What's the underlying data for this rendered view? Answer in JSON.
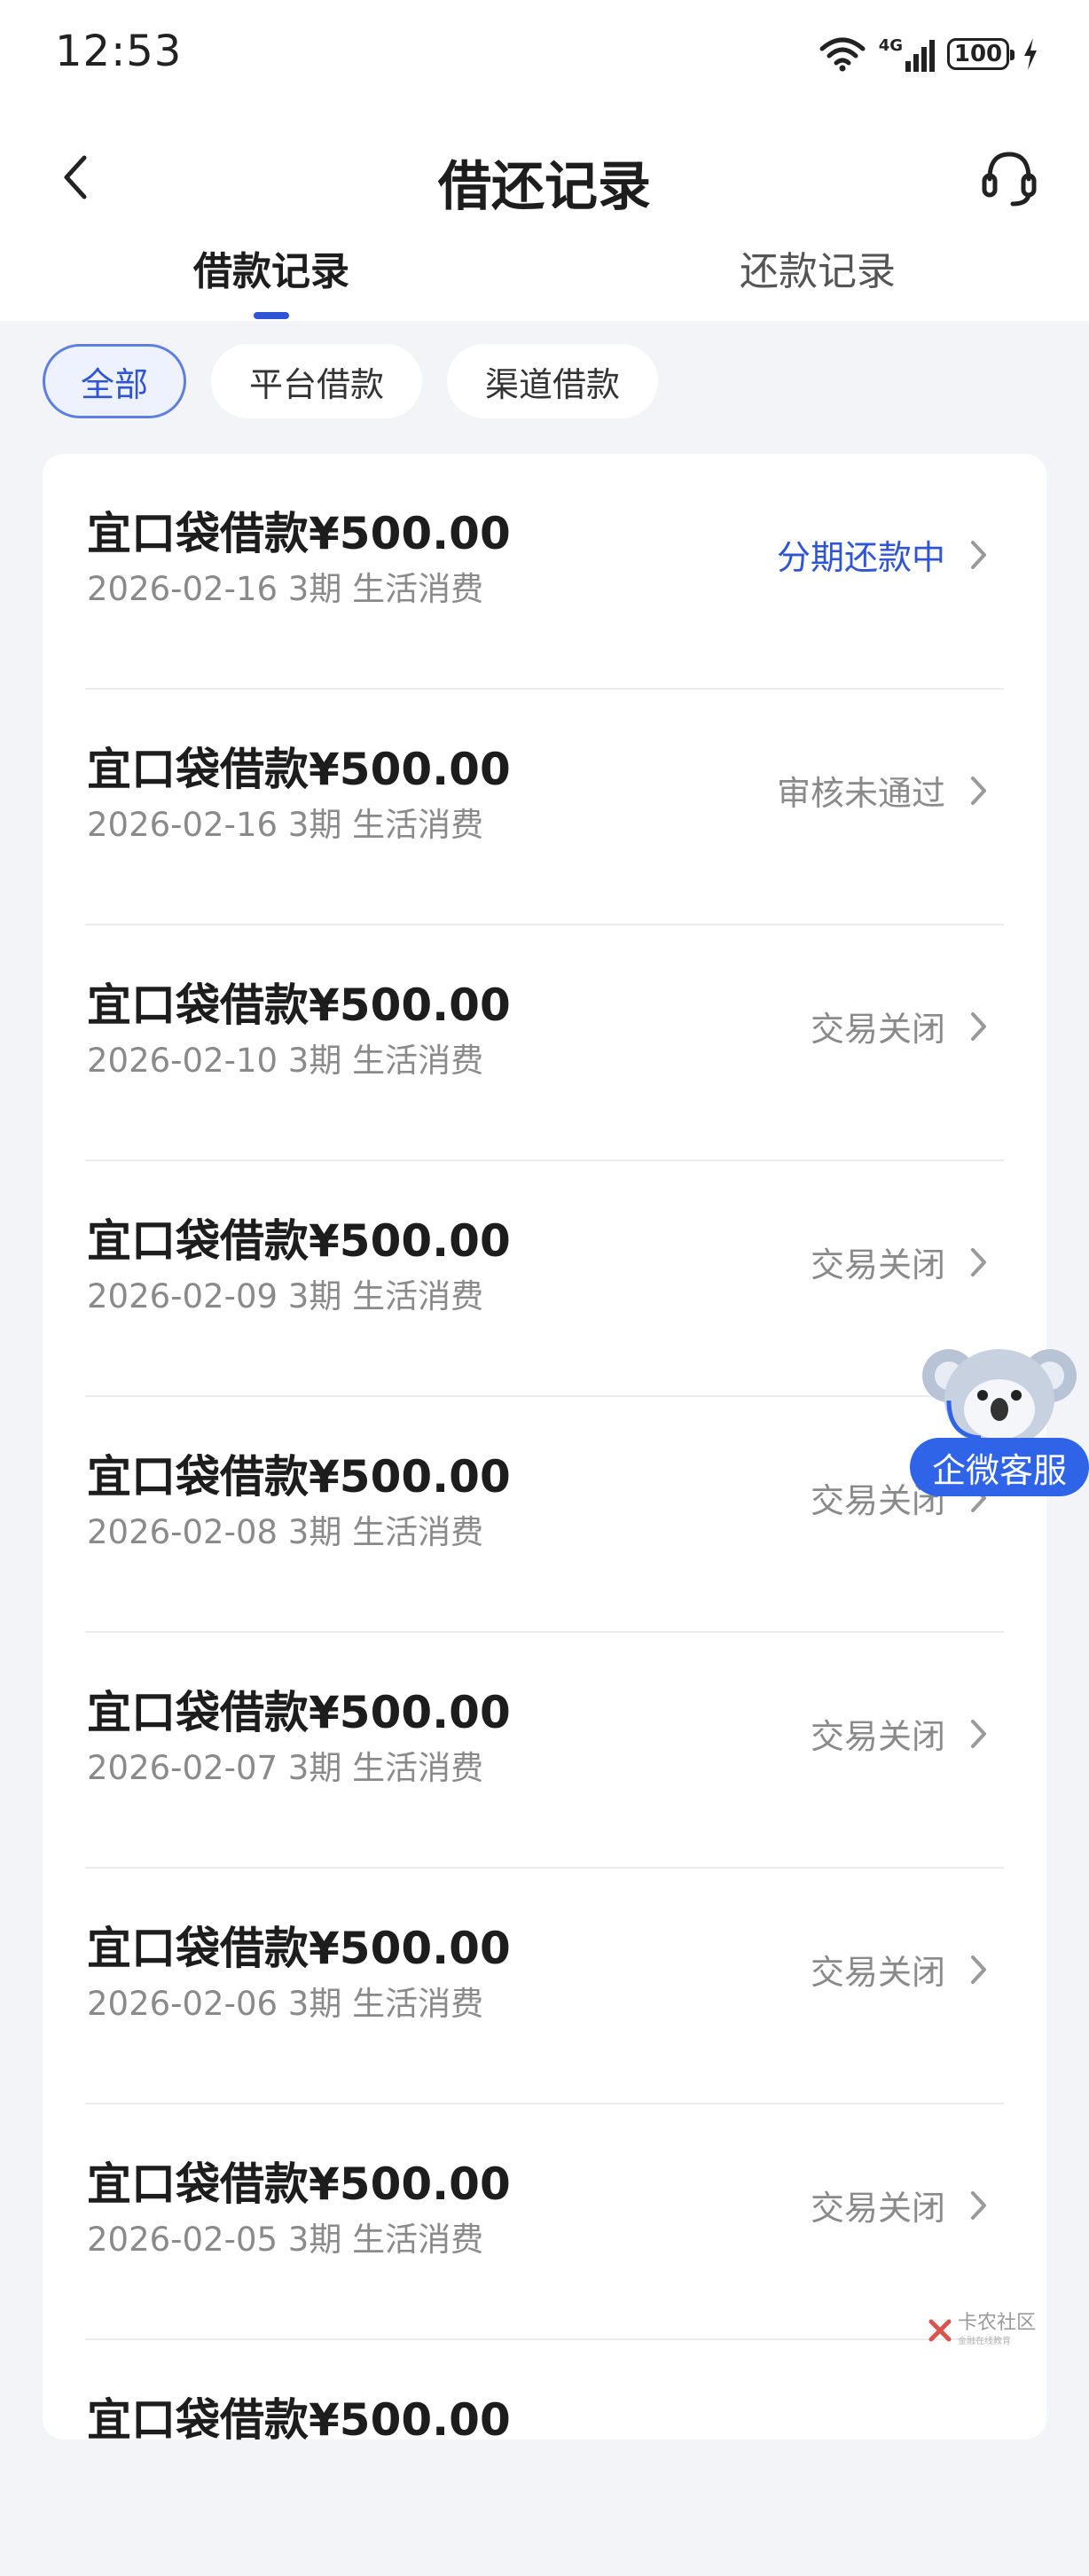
{
  "status_bar": {
    "time": "12:53",
    "network": "4G",
    "battery": "100"
  },
  "header": {
    "title": "借还记录",
    "back_icon": "chevron-left-icon",
    "support_icon": "headset-icon"
  },
  "tabs": [
    {
      "label": "借款记录",
      "active": true
    },
    {
      "label": "还款记录",
      "active": false
    }
  ],
  "filters": [
    {
      "label": "全部",
      "active": true
    },
    {
      "label": "平台借款",
      "active": false
    },
    {
      "label": "渠道借款",
      "active": false
    }
  ],
  "records": [
    {
      "title": "宜口袋借款¥500.00",
      "subtitle": "2026-02-16 3期  生活消费",
      "status": "分期还款中",
      "status_color": "#2f54d6"
    },
    {
      "title": "宜口袋借款¥500.00",
      "subtitle": "2026-02-16 3期  生活消费",
      "status": "审核未通过",
      "status_color": "#8a8a8a"
    },
    {
      "title": "宜口袋借款¥500.00",
      "subtitle": "2026-02-10 3期  生活消费",
      "status": "交易关闭",
      "status_color": "#8a8a8a"
    },
    {
      "title": "宜口袋借款¥500.00",
      "subtitle": "2026-02-09 3期  生活消费",
      "status": "交易关闭",
      "status_color": "#8a8a8a"
    },
    {
      "title": "宜口袋借款¥500.00",
      "subtitle": "2026-02-08 3期  生活消费",
      "status": "交易关闭",
      "status_color": "#8a8a8a"
    },
    {
      "title": "宜口袋借款¥500.00",
      "subtitle": "2026-02-07 3期  生活消费",
      "status": "交易关闭",
      "status_color": "#8a8a8a"
    },
    {
      "title": "宜口袋借款¥500.00",
      "subtitle": "2026-02-06 3期  生活消费",
      "status": "交易关闭",
      "status_color": "#8a8a8a"
    },
    {
      "title": "宜口袋借款¥500.00",
      "subtitle": "2026-02-05 3期  生活消费",
      "status": "交易关闭",
      "status_color": "#8a8a8a"
    },
    {
      "title": "宜口袋借款¥500.00",
      "subtitle": "",
      "status": "",
      "status_color": "#8a8a8a"
    }
  ],
  "floating_service": {
    "label": "企微客服",
    "icon": "koala-mascot-icon"
  },
  "watermark": {
    "text": "卡农社区",
    "sub": "金融在线教育"
  },
  "colors": {
    "accent": "#2f54d6",
    "muted": "#8a8a8a",
    "background": "#f3f4f8"
  }
}
